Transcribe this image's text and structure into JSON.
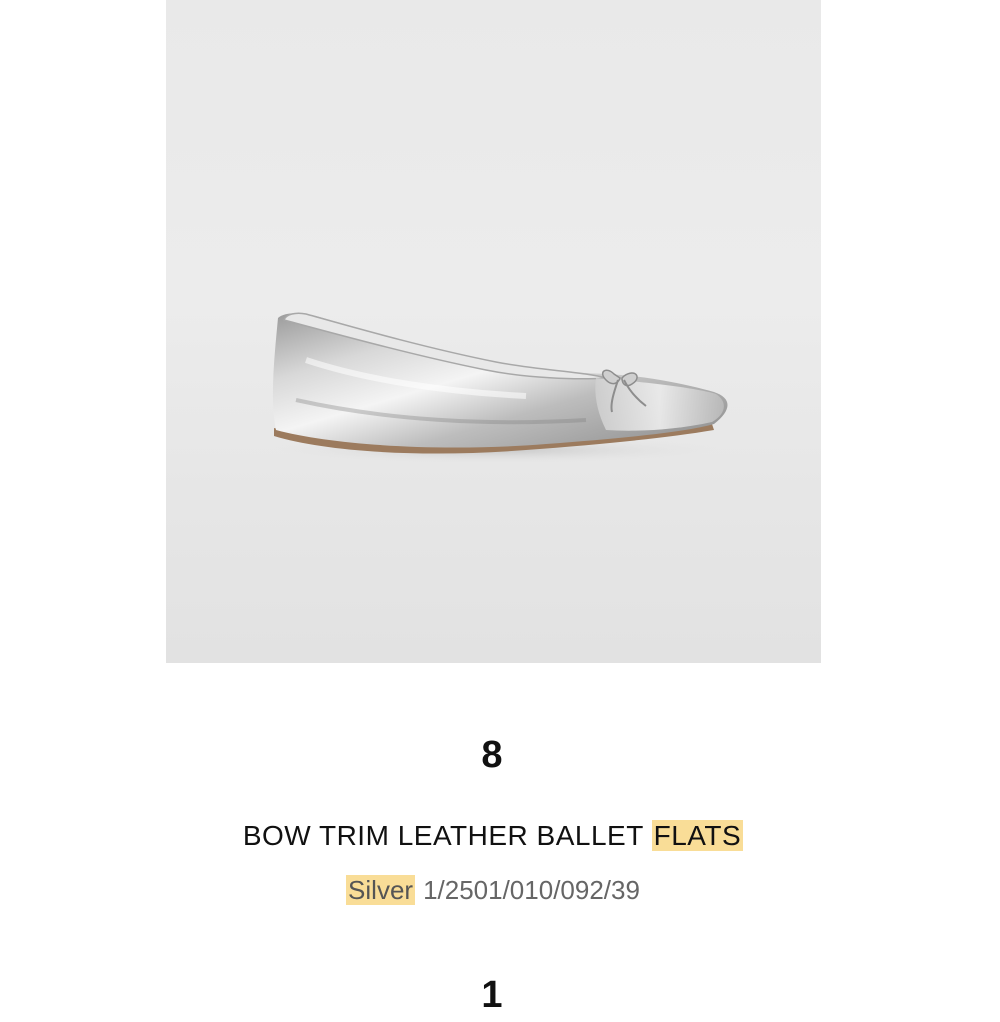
{
  "item": {
    "quantity": "8",
    "name_main": "BOW TRIM LEATHER BALLET ",
    "name_highlight": "FLATS",
    "color": "Silver",
    "reference": "1/2501/010/092/39",
    "image_icon": "silver-ballet-flat-photo"
  },
  "next_item": {
    "quantity": "1"
  },
  "colors": {
    "highlight": "#f9dd97",
    "image_bg": "#e9e9e9",
    "meta_text": "#666666"
  }
}
